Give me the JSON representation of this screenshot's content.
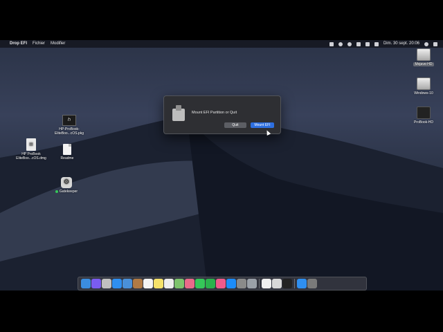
{
  "menubar": {
    "app_name": "Drop EFI",
    "menus": [
      "Fichier",
      "Modifier"
    ],
    "clock": "Dim. 30 sept.  20:06"
  },
  "desktop": {
    "icons_left": [
      {
        "label": "HP-ProBook-EliteBoo...cOS.pkg",
        "icon": "pkg-icon"
      },
      {
        "label": "HP ProBook EliteBoo...cOS.dmg",
        "icon": "dmg-icon"
      },
      {
        "label": "Readme",
        "icon": "document-icon"
      },
      {
        "label": "Gatekeeper",
        "icon": "gatekeeper-app-icon"
      }
    ],
    "icons_right": [
      {
        "label": "Mojave-HD",
        "icon": "hard-disk-icon"
      },
      {
        "label": "Windows-10",
        "icon": "hard-disk-icon"
      },
      {
        "label": "ProBook-HD",
        "icon": "hard-disk-icon"
      }
    ]
  },
  "dialog": {
    "message": "Mount EFI Partition or Quit",
    "quit_label": "Quit",
    "mount_label": "Mount EFI"
  },
  "dock": {
    "apps": [
      "Finder",
      "Siri",
      "Launchpad",
      "Safari",
      "Mail",
      "Contacts",
      "Calendar",
      "Notes",
      "Reminders",
      "Maps",
      "Photos",
      "Messages",
      "FaceTime",
      "iTunes",
      "App Store",
      "System Preferences",
      "Utilities",
      "TextEdit",
      "Preview",
      "Terminal",
      "Downloads",
      "Trash"
    ]
  },
  "colors": {
    "accent": "#2d6fe0",
    "dialog_bg": "#2e2f33"
  }
}
